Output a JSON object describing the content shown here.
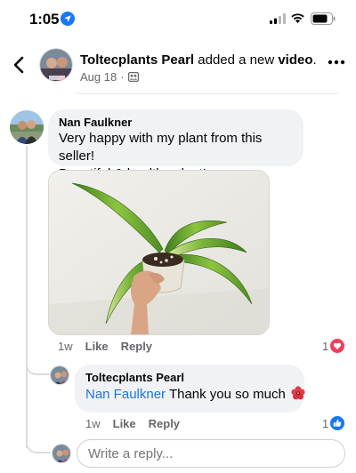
{
  "status_bar": {
    "time": "1:05"
  },
  "header": {
    "author": "Toltecplants Pearl",
    "action": " added a new ",
    "object": "video",
    "suffix": ".",
    "date": "Aug 18",
    "dot": " · "
  },
  "comment": {
    "author": "Nan Faulkner",
    "text_line1": "Very happy with my plant from this seller!",
    "text_line2": "Beautiful & healthy plant!",
    "time": "1w",
    "like_label": "Like",
    "reply_label": "Reply",
    "reaction_count": "1",
    "reaction": "love"
  },
  "reply": {
    "author": "Toltecplants Pearl",
    "mention": "Nan Faulkner",
    "text": " Thank you so much",
    "time": "1w",
    "like_label": "Like",
    "reply_label": "Reply",
    "reaction_count": "1",
    "reaction": "like"
  },
  "composer": {
    "placeholder": "Write a reply..."
  },
  "colors": {
    "link": "#1b74e4",
    "love": "#f33e58",
    "like": "#1877f2",
    "bubble": "#f0f2f5",
    "muted": "#65676b"
  }
}
